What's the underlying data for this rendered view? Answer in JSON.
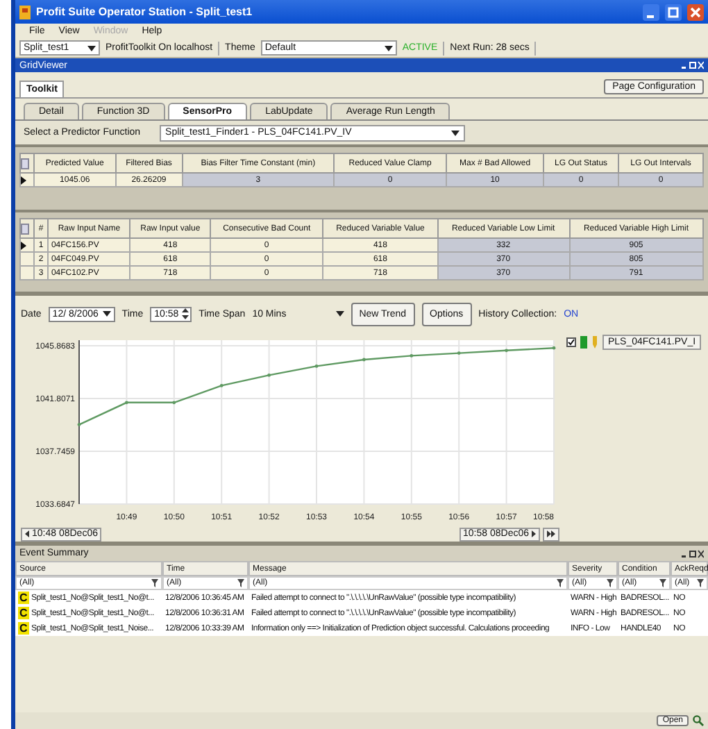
{
  "window": {
    "title": "Profit Suite Operator Station - Split_test1"
  },
  "menu": [
    {
      "label": "File",
      "disabled": false
    },
    {
      "label": "View",
      "disabled": false
    },
    {
      "label": "Window",
      "disabled": true
    },
    {
      "label": "Help",
      "disabled": false
    }
  ],
  "toolbar": {
    "application": "Split_test1",
    "server": "ProfitToolkit On localhost",
    "theme_label": "Theme",
    "theme": "Default",
    "status": "ACTIVE",
    "next_run": "Next Run: 28 secs"
  },
  "viewer": {
    "title": "GridViewer",
    "page_tabs": [
      {
        "label": "Toolkit",
        "selected": true
      }
    ],
    "page_config_button": "Page Configuration",
    "tabs": [
      {
        "label": "Detail",
        "selected": false
      },
      {
        "label": "Function 3D",
        "selected": false
      },
      {
        "label": "SensorPro",
        "selected": true
      },
      {
        "label": "LabUpdate",
        "selected": false
      },
      {
        "label": "Average Run Length",
        "selected": false
      }
    ],
    "predictor": {
      "label": "Select a Predictor Function",
      "value": "Split_test1_Finder1 - PLS_04FC141.PV_IV"
    },
    "predictor_table": {
      "columns": [
        {
          "label": "Predicted Value",
          "editable": false
        },
        {
          "label": "Filtered Bias",
          "editable": false
        },
        {
          "label": "Bias Filter Time Constant (min)",
          "editable": true
        },
        {
          "label": "Reduced Value Clamp",
          "editable": true
        },
        {
          "label": "Max # Bad Allowed",
          "editable": true
        },
        {
          "label": "LG Out Status",
          "editable": true
        },
        {
          "label": "LG Out Intervals",
          "editable": true
        }
      ],
      "rows": [
        {
          "current": true,
          "cells": [
            "1045.06",
            "26.26209",
            "3",
            "0",
            "10",
            "0",
            "0"
          ]
        }
      ]
    },
    "inputs_table": {
      "columns": [
        {
          "label": "#",
          "editable": false
        },
        {
          "label": "Raw Input Name",
          "editable": false
        },
        {
          "label": "Raw Input value",
          "editable": false
        },
        {
          "label": "Consecutive Bad Count",
          "editable": false
        },
        {
          "label": "Reduced Variable Value",
          "editable": false
        },
        {
          "label": "Reduced Variable Low Limit",
          "editable": true
        },
        {
          "label": "Reduced Variable High Limit",
          "editable": true
        }
      ],
      "rows": [
        {
          "current": true,
          "cells": [
            "1",
            "04FC156.PV",
            "418",
            "0",
            "418",
            "332",
            "905"
          ]
        },
        {
          "current": false,
          "cells": [
            "2",
            "04FC049.PV",
            "618",
            "0",
            "618",
            "370",
            "805"
          ]
        },
        {
          "current": false,
          "cells": [
            "3",
            "04FC102.PV",
            "718",
            "0",
            "718",
            "370",
            "791"
          ]
        }
      ]
    }
  },
  "trend": {
    "date_label": "Date",
    "date": "12/ 8/2006",
    "time_label": "Time",
    "time": "10:58",
    "span_label": "Time Span",
    "span": "10 Mins",
    "buttons": [
      "New Trend",
      "Options"
    ],
    "history_label": "History Collection:",
    "history": "ON",
    "start": "10:48 08Dec06",
    "end": "10:58 08Dec06",
    "legend": [
      {
        "checked": true,
        "color": "#1f9a2a"
      }
    ],
    "chart_data": {
      "type": "line",
      "grid": true,
      "ylim": [
        1033.6847,
        1045.8683
      ],
      "categories": [
        null,
        "10:49",
        "10:50",
        "10:51",
        "10:52",
        "10:53",
        "10:54",
        "10:55",
        "10:56",
        "10:57",
        "10:58"
      ],
      "yticks": [
        {
          "value": 1033.6847,
          "label": "1033.6847"
        },
        {
          "value": 1037.7459,
          "label": "1037.7459"
        },
        {
          "value": 1041.8071,
          "label": "1041.8071"
        },
        {
          "value": 1045.8683,
          "label": "1045.8683"
        }
      ],
      "series": [
        {
          "name": "PLS_04FC141.PV_I",
          "color": "#5f9a62",
          "values": [
            1039.8,
            1041.5,
            1041.5,
            1042.8,
            1043.6,
            1044.3,
            1044.8,
            1045.1,
            1045.3,
            1045.5,
            1045.7
          ]
        }
      ]
    }
  },
  "events": {
    "title": "Event Summary",
    "columns": [
      "Source",
      "Time",
      "Message",
      "Severity",
      "Condition",
      "AckReqd"
    ],
    "filters": [
      "(All)",
      "(All)",
      "(All)",
      "(All)",
      "(All)",
      "(All)"
    ],
    "rows": [
      {
        "badge": "C",
        "source": "Split_test1_No@Split_test1_No@t...",
        "time": "12/8/2006 10:36:45 AM",
        "message": "Failed attempt to connect to \".\\.\\.\\.\\.\\UnRawValue\" (possible type incompatibility)",
        "severity": "WARN - High",
        "condition": "BADRESOL...",
        "ack": "NO"
      },
      {
        "badge": "C",
        "source": "Split_test1_No@Split_test1_No@t...",
        "time": "12/8/2006 10:36:31 AM",
        "message": "Failed attempt to connect to \".\\.\\.\\.\\.\\UnRawValue\" (possible type incompatibility)",
        "severity": "WARN - High",
        "condition": "BADRESOL...",
        "ack": "NO"
      },
      {
        "badge": "C",
        "source": "Split_test1_No@Split_test1_Noise...",
        "time": "12/8/2006 10:33:39 AM",
        "message": "Information only ==> Initialization of Prediction object successful. Calculations proceeding",
        "severity": "INFO - Low",
        "condition": "HANDLE40",
        "ack": "NO"
      }
    ],
    "open_button": "Open"
  }
}
